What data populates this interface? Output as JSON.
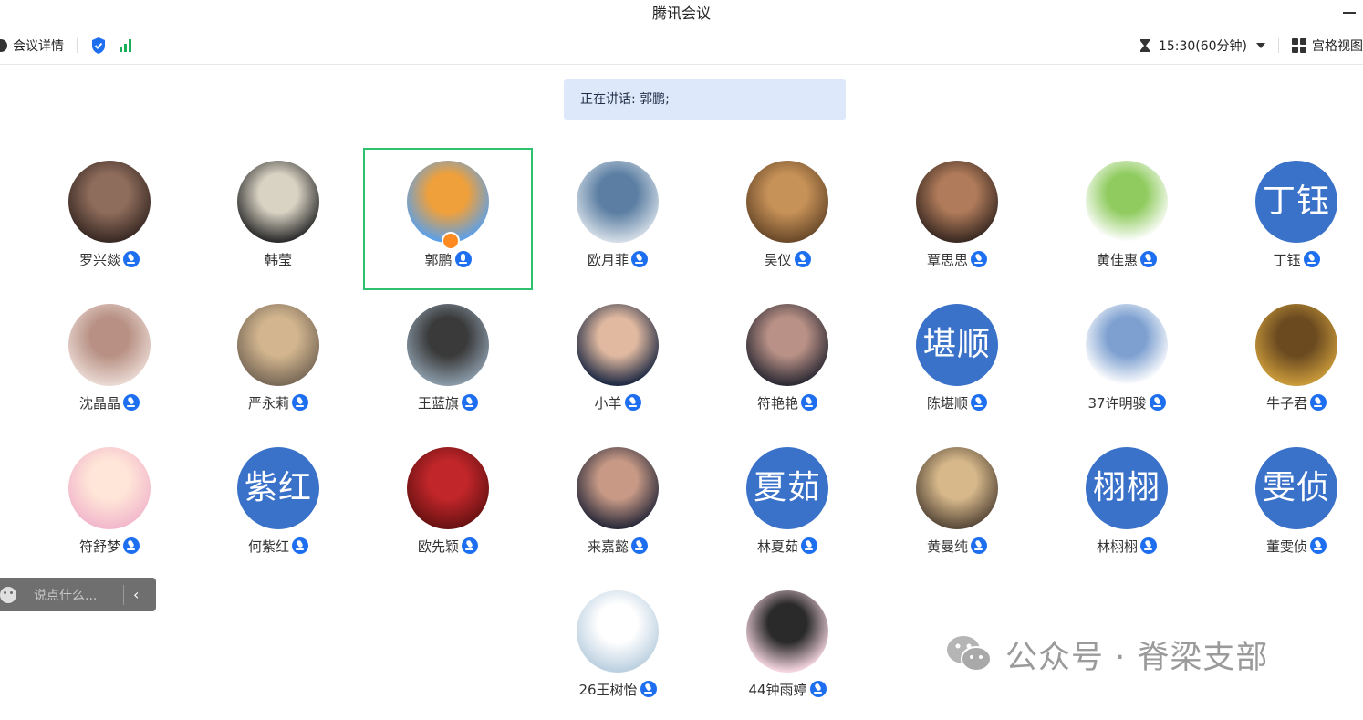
{
  "window": {
    "title": "腾讯会议"
  },
  "toolbar": {
    "details_label": "会议详情",
    "timer": "15:30(60分钟)",
    "view_label": "宫格视图"
  },
  "speaking": {
    "label": "正在讲话:",
    "names": "郭鹏;"
  },
  "participants": [
    {
      "name": "罗兴燚",
      "avatar_type": "photo",
      "mic": true,
      "colors": [
        "#3a2a24",
        "#8f6d5c"
      ]
    },
    {
      "name": "韩莹",
      "avatar_type": "photo",
      "mic": false,
      "colors": [
        "#2c2c2c",
        "#d9d3c4"
      ]
    },
    {
      "name": "郭鹏",
      "avatar_type": "photo",
      "mic": true,
      "host": true,
      "colors": [
        "#5ca0e8",
        "#f0a03a"
      ]
    },
    {
      "name": "欧月菲",
      "avatar_type": "photo",
      "mic": true,
      "colors": [
        "#d2dce6",
        "#5b7ea2"
      ]
    },
    {
      "name": "吴仪",
      "avatar_type": "photo",
      "mic": true,
      "colors": [
        "#6b4a2a",
        "#c79258"
      ]
    },
    {
      "name": "覃思思",
      "avatar_type": "photo",
      "mic": true,
      "colors": [
        "#3b2a22",
        "#b07b5a"
      ]
    },
    {
      "name": "黄佳惠",
      "avatar_type": "photo",
      "mic": true,
      "colors": [
        "#ffffff",
        "#8fcb5e"
      ]
    },
    {
      "name": "丁钰",
      "avatar_type": "text",
      "avatar_text": "丁钰",
      "mic": true
    },
    {
      "name": "沈晶晶",
      "avatar_type": "photo",
      "mic": true,
      "colors": [
        "#e9d8d2",
        "#b89184"
      ]
    },
    {
      "name": "严永莉",
      "avatar_type": "photo",
      "mic": true,
      "colors": [
        "#7a6a58",
        "#d3b68f"
      ]
    },
    {
      "name": "王蓝旗",
      "avatar_type": "photo",
      "mic": true,
      "colors": [
        "#8a9aa8",
        "#3a3a3a"
      ]
    },
    {
      "name": "小羊",
      "avatar_type": "photo",
      "mic": true,
      "colors": [
        "#1f2a44",
        "#e0b9a0"
      ]
    },
    {
      "name": "符艳艳",
      "avatar_type": "photo",
      "mic": true,
      "colors": [
        "#2e2b35",
        "#b99186"
      ]
    },
    {
      "name": "陈堪顺",
      "avatar_type": "text",
      "avatar_text": "堪顺",
      "mic": true
    },
    {
      "name": "37许明骏",
      "avatar_type": "photo",
      "mic": true,
      "colors": [
        "#ffffff",
        "#7da0d0"
      ]
    },
    {
      "name": "牛子君",
      "avatar_type": "photo",
      "mic": true,
      "colors": [
        "#c99a3a",
        "#6b4a20"
      ]
    },
    {
      "name": "符舒梦",
      "avatar_type": "photo",
      "mic": true,
      "colors": [
        "#f2b8cc",
        "#ffe6d8"
      ]
    },
    {
      "name": "何紫红",
      "avatar_type": "text",
      "avatar_text": "紫红",
      "mic": true
    },
    {
      "name": "欧先颖",
      "avatar_type": "photo",
      "mic": true,
      "colors": [
        "#6a1212",
        "#c0262a"
      ]
    },
    {
      "name": "来嘉懿",
      "avatar_type": "photo",
      "mic": true,
      "colors": [
        "#2a2a3a",
        "#c89a86"
      ]
    },
    {
      "name": "林夏茹",
      "avatar_type": "text",
      "avatar_text": "夏茹",
      "mic": true
    },
    {
      "name": "黄曼纯",
      "avatar_type": "photo",
      "mic": true,
      "colors": [
        "#5a4a3a",
        "#d6b88a"
      ]
    },
    {
      "name": "林栩栩",
      "avatar_type": "text",
      "avatar_text": "栩栩",
      "mic": true
    },
    {
      "name": "董雯侦",
      "avatar_type": "text",
      "avatar_text": "雯侦",
      "mic": true
    },
    {
      "name": "26王树怡",
      "avatar_type": "photo",
      "mic": true,
      "colors": [
        "#bcd0e0",
        "#ffffff"
      ]
    },
    {
      "name": "44钟雨婷",
      "avatar_type": "photo",
      "mic": true,
      "colors": [
        "#f5d5df",
        "#2a2a2a"
      ]
    }
  ],
  "chat": {
    "placeholder": "说点什么..."
  },
  "watermark": {
    "text": "公众号 · 脊梁支部"
  },
  "colors": {
    "accent": "#1e6ff0",
    "active_border": "#2fc070",
    "text_avatar_bg": "#3a71c9",
    "banner_bg": "#dde9fb"
  }
}
